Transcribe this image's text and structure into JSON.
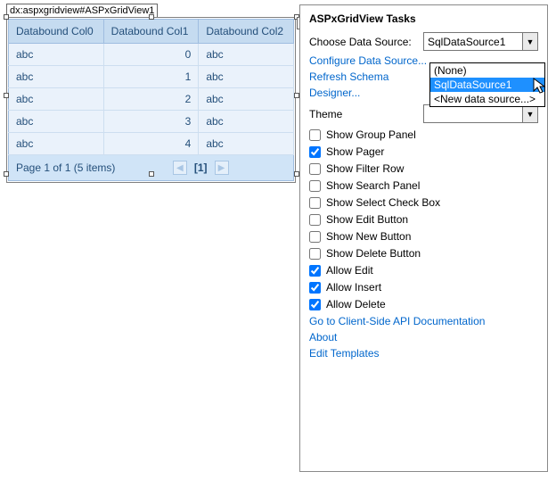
{
  "designer_tag": "dx:aspxgridview#ASPxGridView1",
  "grid": {
    "columns": [
      "Databound Col0",
      "Databound Col1",
      "Databound Col2"
    ],
    "rows": [
      [
        "abc",
        "0",
        "abc"
      ],
      [
        "abc",
        "1",
        "abc"
      ],
      [
        "abc",
        "2",
        "abc"
      ],
      [
        "abc",
        "3",
        "abc"
      ],
      [
        "abc",
        "4",
        "abc"
      ]
    ],
    "pager_info": "Page 1 of 1 (5 items)",
    "pager_current": "[1]"
  },
  "tasks": {
    "title": "ASPxGridView Tasks",
    "datasource_label": "Choose Data Source:",
    "datasource_value": "SqlDataSource1",
    "configure_link": "Configure Data Source...",
    "refresh_link": "Refresh Schema",
    "designer_link": "Designer...",
    "theme_label": "Theme",
    "theme_value": "",
    "checks": [
      {
        "label": "Show Group Panel",
        "checked": false
      },
      {
        "label": "Show Pager",
        "checked": true
      },
      {
        "label": "Show Filter Row",
        "checked": false
      },
      {
        "label": "Show Search Panel",
        "checked": false
      },
      {
        "label": "Show Select Check Box",
        "checked": false
      },
      {
        "label": "Show Edit Button",
        "checked": false
      },
      {
        "label": "Show New Button",
        "checked": false
      },
      {
        "label": "Show Delete Button",
        "checked": false
      },
      {
        "label": "Allow Edit",
        "checked": true
      },
      {
        "label": "Allow Insert",
        "checked": true
      },
      {
        "label": "Allow Delete",
        "checked": true
      }
    ],
    "footer_links": [
      "Go to Client-Side API Documentation",
      "About",
      "Edit Templates"
    ]
  },
  "dropdown": {
    "options": [
      "(None)",
      "SqlDataSource1",
      "<New data source...>"
    ],
    "selected_index": 1
  }
}
